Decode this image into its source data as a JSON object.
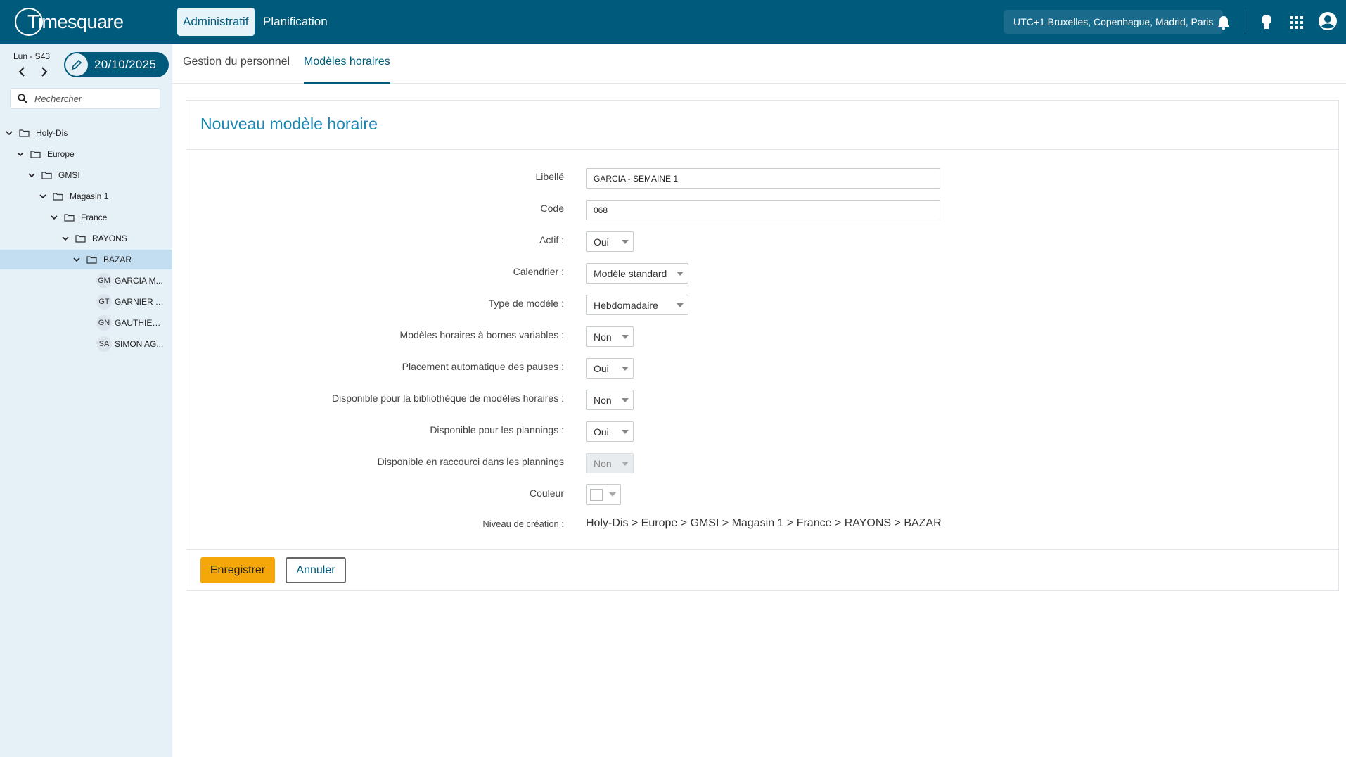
{
  "app": {
    "name": "Timesquare"
  },
  "topnav": {
    "tabs": [
      {
        "label": "Administratif",
        "active": true
      },
      {
        "label": "Planification",
        "active": false
      }
    ],
    "timezone": "UTC+1 Bruxelles, Copenhague, Madrid, Paris",
    "icons": [
      "bell-icon",
      "lightbulb-icon",
      "apps-grid-icon",
      "user-account-icon"
    ]
  },
  "sidebar": {
    "day_label": "Lun - S43",
    "date": "20/10/2025",
    "search": {
      "placeholder": "Rechercher",
      "value": ""
    },
    "tree": [
      {
        "label": "Holy-Dis",
        "level": 0
      },
      {
        "label": "Europe",
        "level": 1
      },
      {
        "label": "GMSI",
        "level": 2
      },
      {
        "label": "Magasin 1",
        "level": 3
      },
      {
        "label": "France",
        "level": 4
      },
      {
        "label": "RAYONS",
        "level": 5
      },
      {
        "label": "BAZAR",
        "level": 6,
        "selected": true
      }
    ],
    "people": [
      {
        "initials": "GM",
        "name": "GARCIA M..."
      },
      {
        "initials": "GT",
        "name": "GARNIER T..."
      },
      {
        "initials": "GN",
        "name": "GAUTHIER..."
      },
      {
        "initials": "SA",
        "name": "SIMON AG..."
      }
    ]
  },
  "subtabs": [
    {
      "label": "Gestion du personnel",
      "active": false
    },
    {
      "label": "Modèles horaires",
      "active": true
    }
  ],
  "form": {
    "title": "Nouveau modèle horaire",
    "fields": {
      "libelle": {
        "label": "Libellé",
        "value": "GARCIA - SEMAINE 1"
      },
      "code": {
        "label": "Code",
        "value": "068"
      },
      "actif": {
        "label": "Actif :",
        "value": "Oui"
      },
      "calendrier": {
        "label": "Calendrier :",
        "value": "Modèle standard"
      },
      "type_modele": {
        "label": "Type de modèle :",
        "value": "Hebdomadaire"
      },
      "bornes_variables": {
        "label": "Modèles horaires à bornes variables :",
        "value": "Non"
      },
      "placement_pauses": {
        "label": "Placement automatique des pauses :",
        "value": "Oui"
      },
      "bibliotheque": {
        "label": "Disponible pour la bibliothèque de modèles horaires :",
        "value": "Non"
      },
      "plannings": {
        "label": "Disponible pour les plannings :",
        "value": "Oui"
      },
      "raccourci": {
        "label": "Disponible en raccourci dans les plannings",
        "value": "Non",
        "disabled": true
      },
      "couleur": {
        "label": "Couleur",
        "value": "#ffffff"
      },
      "niveau": {
        "label": "Niveau de création :",
        "value": "Holy-Dis > Europe > GMSI > Magasin 1 > France > RAYONS > BAZAR"
      }
    },
    "buttons": {
      "save": "Enregistrer",
      "cancel": "Annuler"
    }
  },
  "colors": {
    "brand": "#005a7c",
    "accent": "#1a87b3",
    "save_button": "#f5a70a",
    "sidebar_bg": "#e6f0f7",
    "selected_row": "#c2def0"
  }
}
